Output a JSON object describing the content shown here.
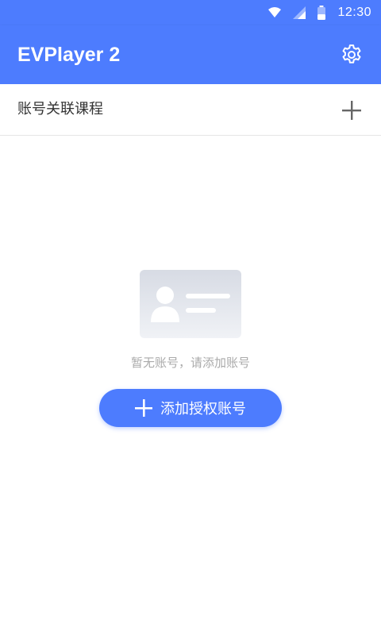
{
  "status_bar": {
    "time": "12:30",
    "icons": [
      "wifi-icon",
      "signal-icon",
      "battery-icon"
    ]
  },
  "app_bar": {
    "title": "EVPlayer 2",
    "settings_icon": "gear-icon"
  },
  "section": {
    "title": "账号关联课程",
    "add_icon": "plus-icon"
  },
  "empty_state": {
    "illustration": "account-card-illustration",
    "message": "暂无账号，请添加账号",
    "button_label": "添加授权账号",
    "button_icon": "plus-icon"
  },
  "colors": {
    "primary": "#4d7cfe",
    "text": "#333333",
    "muted": "#aaaaaa",
    "divider": "#e6e6e6"
  }
}
